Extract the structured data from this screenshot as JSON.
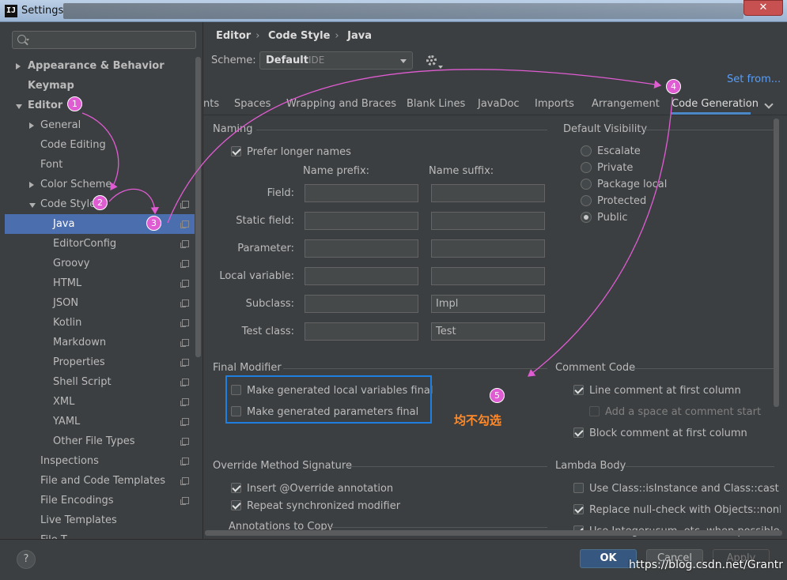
{
  "window": {
    "title": "Settings",
    "app_icon": "IJ",
    "close_symbol": "✕"
  },
  "sidebar": {
    "search_placeholder": "",
    "items": [
      {
        "label": "Appearance & Behavior",
        "indent": 0,
        "arrow": "right",
        "bold": true
      },
      {
        "label": "Keymap",
        "indent": 0,
        "arrow": "",
        "bold": true
      },
      {
        "label": "Editor",
        "indent": 0,
        "arrow": "down",
        "bold": true
      },
      {
        "label": "General",
        "indent": 1,
        "arrow": "right"
      },
      {
        "label": "Code Editing",
        "indent": 1,
        "arrow": ""
      },
      {
        "label": "Font",
        "indent": 1,
        "arrow": ""
      },
      {
        "label": "Color Scheme",
        "indent": 1,
        "arrow": "right"
      },
      {
        "label": "Code Style",
        "indent": 1,
        "arrow": "down",
        "copy": true
      },
      {
        "label": "Java",
        "indent": 2,
        "arrow": "",
        "copy": true,
        "selected": true
      },
      {
        "label": "EditorConfig",
        "indent": 2,
        "arrow": "",
        "copy": true
      },
      {
        "label": "Groovy",
        "indent": 2,
        "arrow": "",
        "copy": true
      },
      {
        "label": "HTML",
        "indent": 2,
        "arrow": "",
        "copy": true
      },
      {
        "label": "JSON",
        "indent": 2,
        "arrow": "",
        "copy": true
      },
      {
        "label": "Kotlin",
        "indent": 2,
        "arrow": "",
        "copy": true
      },
      {
        "label": "Markdown",
        "indent": 2,
        "arrow": "",
        "copy": true
      },
      {
        "label": "Properties",
        "indent": 2,
        "arrow": "",
        "copy": true
      },
      {
        "label": "Shell Script",
        "indent": 2,
        "arrow": "",
        "copy": true
      },
      {
        "label": "XML",
        "indent": 2,
        "arrow": "",
        "copy": true
      },
      {
        "label": "YAML",
        "indent": 2,
        "arrow": "",
        "copy": true
      },
      {
        "label": "Other File Types",
        "indent": 2,
        "arrow": "",
        "copy": true
      },
      {
        "label": "Inspections",
        "indent": 1,
        "arrow": "",
        "copy": true
      },
      {
        "label": "File and Code Templates",
        "indent": 1,
        "arrow": "",
        "copy": true
      },
      {
        "label": "File Encodings",
        "indent": 1,
        "arrow": "",
        "copy": true
      },
      {
        "label": "Live Templates",
        "indent": 1,
        "arrow": ""
      },
      {
        "label": "File T...",
        "indent": 1,
        "arrow": ""
      }
    ]
  },
  "breadcrumb": [
    "Editor",
    "Code Style",
    "Java"
  ],
  "breadcrumb_sep": "›",
  "scheme": {
    "label": "Scheme:",
    "value": "Default",
    "sub": "IDE"
  },
  "set_from": "Set from...",
  "tabs": [
    "nts",
    "Spaces",
    "Wrapping and Braces",
    "Blank Lines",
    "JavaDoc",
    "Imports",
    "Arrangement",
    "Code Generation"
  ],
  "naming": {
    "title": "Naming",
    "prefer_longer": "Prefer longer names",
    "prefix_header": "Name prefix:",
    "suffix_header": "Name suffix:",
    "rows": [
      {
        "label": "Field:",
        "prefix": "",
        "suffix": ""
      },
      {
        "label": "Static field:",
        "prefix": "",
        "suffix": ""
      },
      {
        "label": "Parameter:",
        "prefix": "",
        "suffix": ""
      },
      {
        "label": "Local variable:",
        "prefix": "",
        "suffix": ""
      },
      {
        "label": "Subclass:",
        "prefix": "",
        "suffix": "Impl"
      },
      {
        "label": "Test class:",
        "prefix": "",
        "suffix": "Test"
      }
    ]
  },
  "visibility": {
    "title": "Default Visibility",
    "options": [
      "Escalate",
      "Private",
      "Package local",
      "Protected",
      "Public"
    ],
    "selected": "Public"
  },
  "final_modifier": {
    "title": "Final Modifier",
    "local_vars": "Make generated local variables final",
    "params": "Make generated parameters final"
  },
  "comment_code": {
    "title": "Comment Code",
    "line_first": "Line comment at first column",
    "add_space": "Add a space at comment start",
    "block_first": "Block comment at first column"
  },
  "override": {
    "title": "Override Method Signature",
    "insert_override": "Insert @Override annotation",
    "repeat_sync": "Repeat synchronized modifier",
    "annotations_copy": "Annotations to Copy"
  },
  "lambda": {
    "title": "Lambda Body",
    "isinstance": "Use Class::isInstance and Class::cast when",
    "nullcheck": "Replace null-check with Objects::nonNull o",
    "integer_sum": "Use Integer::sum, etc. when possible"
  },
  "annotation": {
    "note": "均不勾选",
    "badges": [
      "1",
      "2",
      "3",
      "4",
      "5"
    ],
    "color": "#e05cd3"
  },
  "buttons": {
    "help": "?",
    "ok": "OK",
    "cancel": "Cancel",
    "apply": "Apply"
  },
  "watermark": "https://blog.csdn.net/Grantr"
}
